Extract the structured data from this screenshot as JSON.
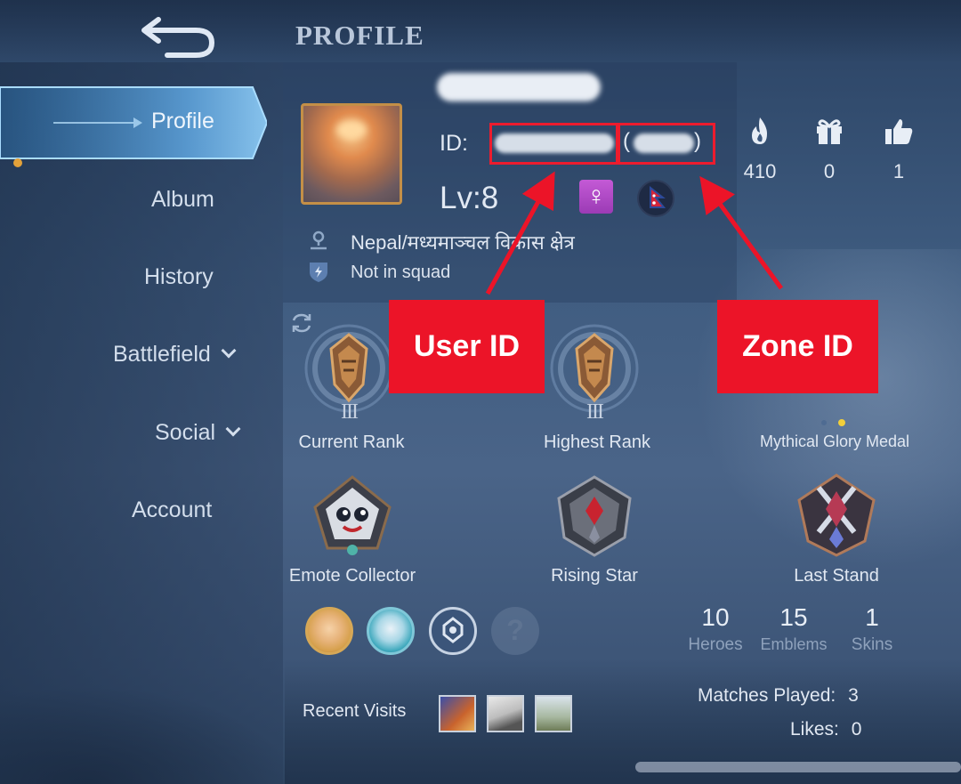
{
  "page": {
    "title": "PROFILE"
  },
  "sidebar": {
    "items": [
      {
        "label": "Profile",
        "active": true
      },
      {
        "label": "Album"
      },
      {
        "label": "History"
      },
      {
        "label": "Battlefield",
        "has_dropdown": true
      },
      {
        "label": "Social",
        "has_dropdown": true
      },
      {
        "label": "Account"
      }
    ]
  },
  "profile": {
    "id_label": "ID:",
    "zone_open": "(",
    "zone_close": ")",
    "level": "Lv:8",
    "gender_symbol": "♀",
    "location": "Nepal/मध्यमाञ्चल विकास क्षेत्र",
    "squad_status": "Not in squad"
  },
  "stats": [
    {
      "icon": "flame-icon",
      "value": "410"
    },
    {
      "icon": "gift-icon",
      "value": "0"
    },
    {
      "icon": "thumbs-up-icon",
      "value": "1"
    }
  ],
  "ranks": [
    {
      "caption": "Current Rank",
      "tier": "III"
    },
    {
      "caption": "Highest Rank",
      "tier": "III"
    },
    {
      "caption": "Mythical Glory Medal"
    }
  ],
  "achievements": [
    "Emote Collector",
    "Rising Star",
    "Last Stand"
  ],
  "collection": [
    {
      "value": "10",
      "label": "Heroes"
    },
    {
      "value": "15",
      "label": "Emblems"
    },
    {
      "value": "1",
      "label": "Skins"
    }
  ],
  "unknown_hero": "?",
  "recent_visits_label": "Recent Visits",
  "matches": {
    "label": "Matches Played:",
    "value": "3"
  },
  "likes": {
    "label": "Likes:",
    "value": "0"
  },
  "annotations": {
    "user_id": "User ID",
    "zone_id": "Zone ID"
  },
  "colors": {
    "callout": "#ec1428",
    "avatar_border": "#c48f47",
    "gender_badge": "#b94bcc",
    "active_tab": "#5fa6e0"
  }
}
